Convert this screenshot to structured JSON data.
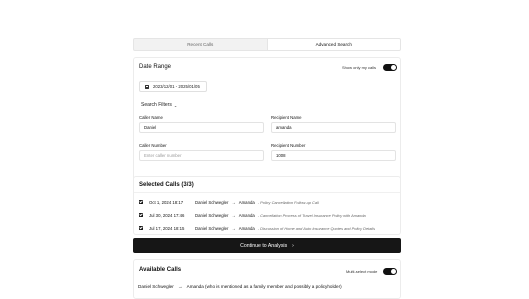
{
  "tabs": [
    {
      "label": "Recent Calls"
    },
    {
      "label": "Advanced Search"
    }
  ],
  "date_range": {
    "title": "Date Range",
    "value": "2023/12/01 - 2025/01/05"
  },
  "show_only_my_calls": {
    "label": "Show only my calls",
    "enabled": true
  },
  "search_filters": {
    "label": "Search Filters",
    "caller_name": {
      "label": "Caller Name",
      "value": "Daniel"
    },
    "recipient_name": {
      "label": "Recipient Name",
      "value": "amanda"
    },
    "caller_number": {
      "label": "Caller Number",
      "value": "",
      "placeholder": "Enter caller number"
    },
    "recipient_number": {
      "label": "Recipient Number",
      "value": "1008"
    }
  },
  "selected_calls": {
    "title": "Selected Calls (3/3)",
    "items": [
      {
        "checked": true,
        "date": "Oct 1, 2024 18:17",
        "from": "Daniel Schwegler",
        "arrow": "→",
        "to": "Amanda",
        "desc": "- Policy Cancellation Follow-up Call"
      },
      {
        "checked": true,
        "date": "Jul 30, 2024 17:46",
        "from": "Daniel Schwegler",
        "arrow": "→",
        "to": "Amanda",
        "desc": "- Cancellation Process of Travel Insurance Policy with Amanda"
      },
      {
        "checked": true,
        "date": "Jul 17, 2024 18:15",
        "from": "Daniel Schwegler",
        "arrow": "→",
        "to": "Amanda",
        "desc": "- Discussion of Home and Auto Insurance Quotes and Policy Details"
      }
    ]
  },
  "continue_button": {
    "label": "Continue to Analysis",
    "arrow": "›"
  },
  "available_calls": {
    "title": "Available Calls",
    "multi_select": {
      "label": "Multi-select mode",
      "enabled": true
    },
    "items": [
      {
        "from": "Daniel Schwegler",
        "arrow": "→",
        "to": "Amanda (who is mentioned as a family member and possibly a policyholder)"
      }
    ]
  },
  "colors": {
    "primary": "#161616",
    "border": "#ececec",
    "muted": "#666666"
  }
}
